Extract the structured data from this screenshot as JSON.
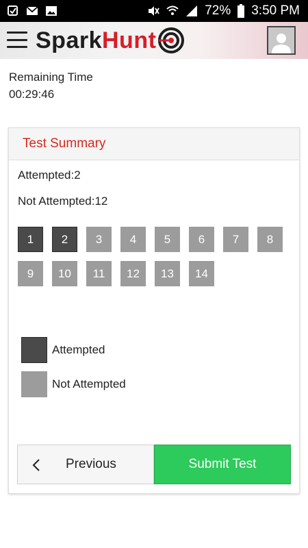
{
  "status_bar": {
    "icons_left": [
      "app-checkbox-icon",
      "gmail-icon",
      "gallery-icon"
    ],
    "icons_right": [
      "mute-icon",
      "wifi-icon",
      "signal-icon",
      "battery-icon"
    ],
    "battery": "72%",
    "time": "3:50 PM"
  },
  "app": {
    "logo_part1": "Spark",
    "logo_part2": "Hunt",
    "brand_red": "#d81e28"
  },
  "timer": {
    "label": "Remaining Time",
    "value": "00:29:46"
  },
  "summary": {
    "title": "Test Summary",
    "attempted_text": "Attempted:2",
    "not_attempted_text": "Not Attempted:12",
    "questions": [
      {
        "number": "1",
        "status": "attempted"
      },
      {
        "number": "2",
        "status": "attempted"
      },
      {
        "number": "3",
        "status": "not-attempted"
      },
      {
        "number": "4",
        "status": "not-attempted"
      },
      {
        "number": "5",
        "status": "not-attempted"
      },
      {
        "number": "6",
        "status": "not-attempted"
      },
      {
        "number": "7",
        "status": "not-attempted"
      },
      {
        "number": "8",
        "status": "not-attempted"
      },
      {
        "number": "9",
        "status": "not-attempted"
      },
      {
        "number": "10",
        "status": "not-attempted"
      },
      {
        "number": "11",
        "status": "not-attempted"
      },
      {
        "number": "12",
        "status": "not-attempted"
      },
      {
        "number": "13",
        "status": "not-attempted"
      },
      {
        "number": "14",
        "status": "not-attempted"
      }
    ],
    "legend_attempted": "Attempted",
    "legend_not_attempted": "Not Attempted",
    "colors": {
      "attempted": "#4a4a4a",
      "not_attempted": "#9c9c9c",
      "title": "#d8281f",
      "submit": "#2dca5c"
    }
  },
  "actions": {
    "previous_label": "Previous",
    "submit_label": "Submit Test"
  }
}
